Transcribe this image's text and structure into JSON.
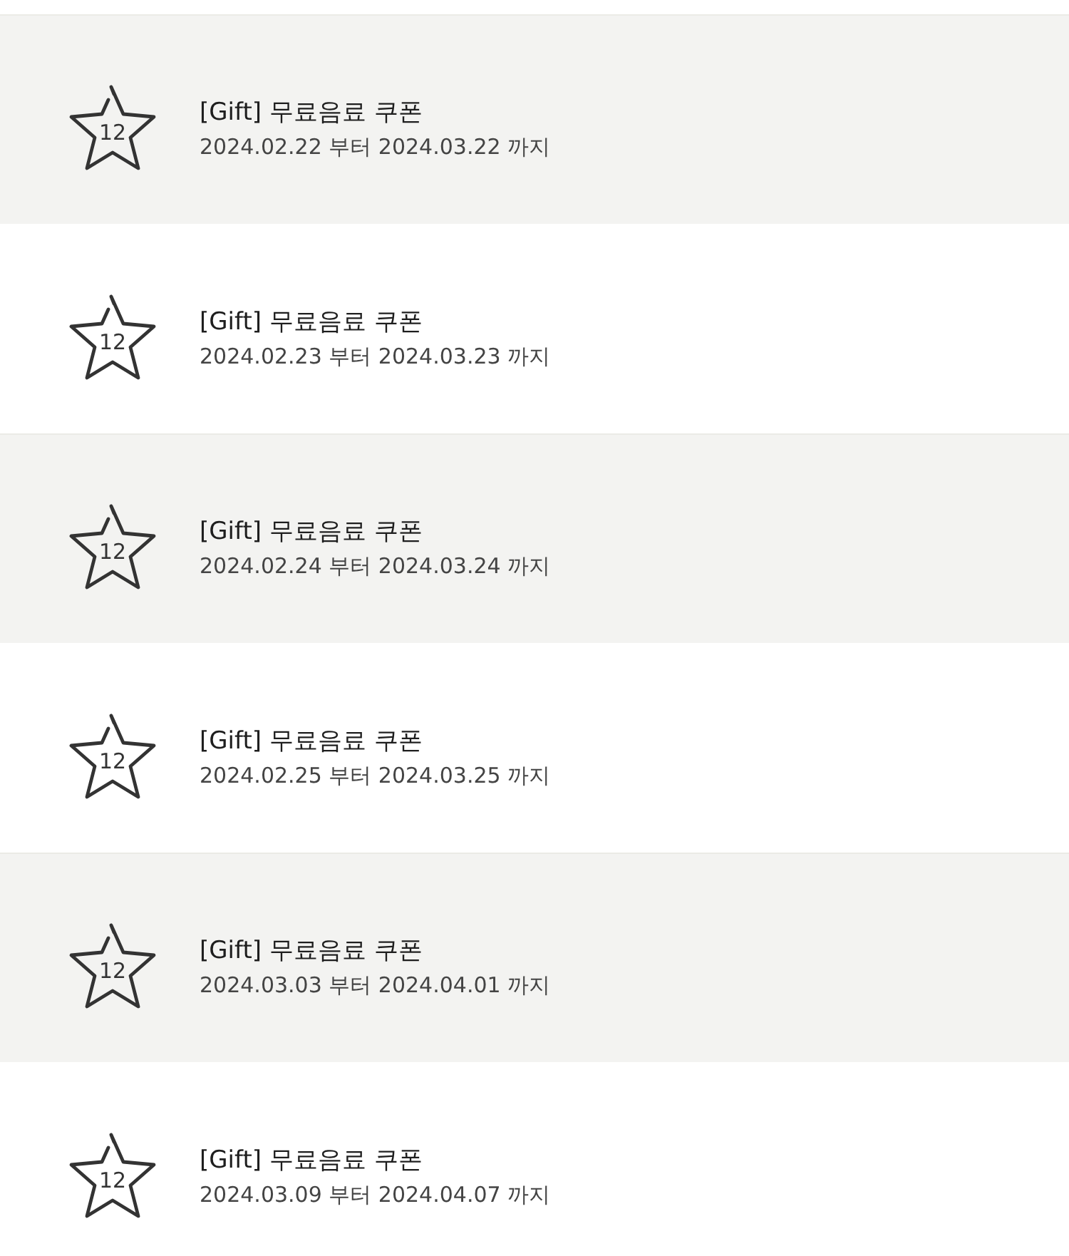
{
  "coupons": [
    {
      "badge": "12",
      "title": "[Gift] 무료음료 쿠폰",
      "period": "2024.02.22 부터 2024.03.22 까지"
    },
    {
      "badge": "12",
      "title": "[Gift] 무료음료 쿠폰",
      "period": "2024.02.23 부터 2024.03.23 까지"
    },
    {
      "badge": "12",
      "title": "[Gift] 무료음료 쿠폰",
      "period": "2024.02.24 부터 2024.03.24 까지"
    },
    {
      "badge": "12",
      "title": "[Gift] 무료음료 쿠폰",
      "period": "2024.02.25 부터 2024.03.25 까지"
    },
    {
      "badge": "12",
      "title": "[Gift] 무료음료 쿠폰",
      "period": "2024.03.03 부터 2024.04.01 까지"
    },
    {
      "badge": "12",
      "title": "[Gift] 무료음료 쿠폰",
      "period": "2024.03.09 부터 2024.04.07 까지"
    }
  ]
}
